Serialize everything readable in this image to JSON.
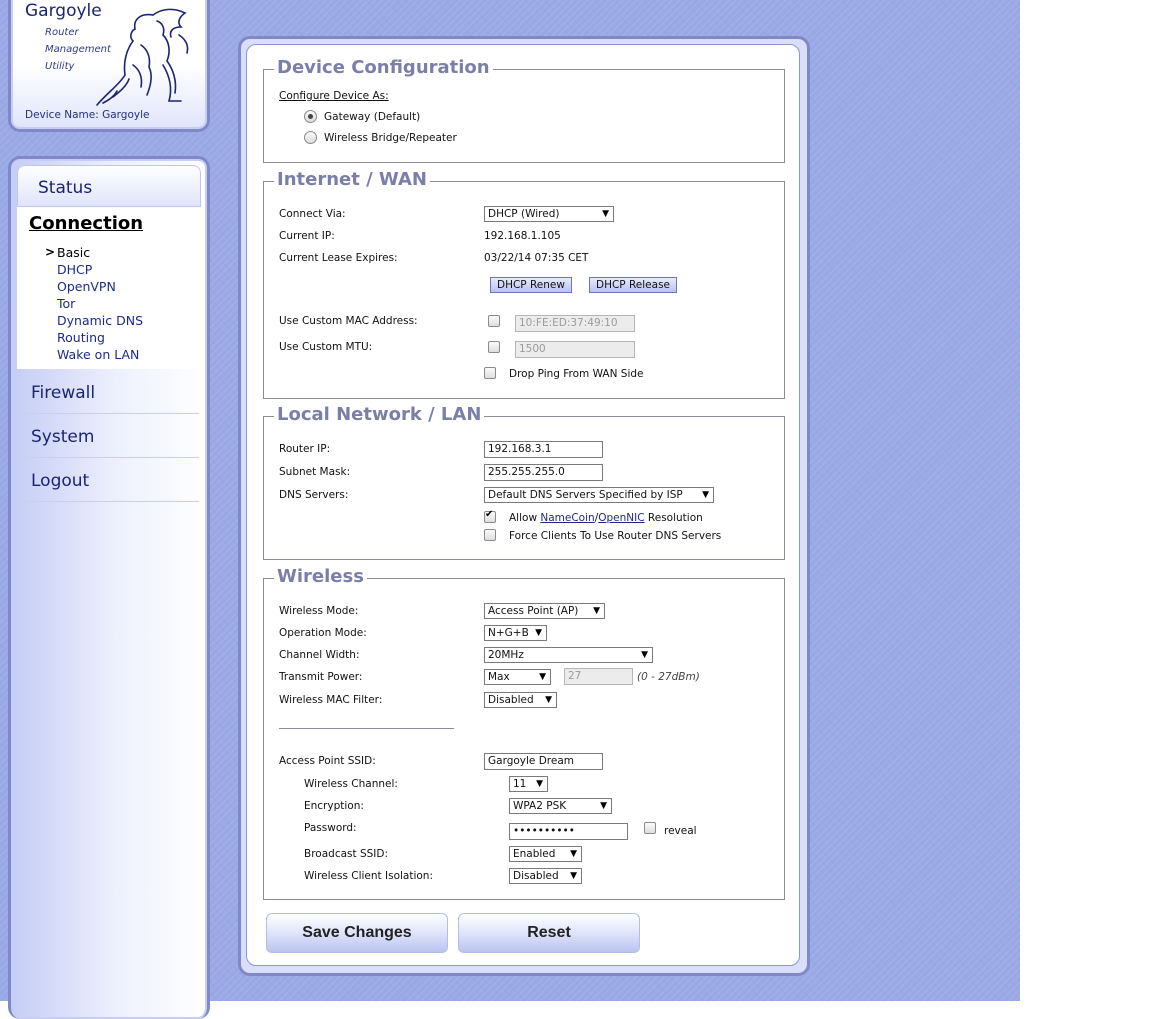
{
  "logo": {
    "title": "Gargoyle",
    "sub1": "Router",
    "sub2": "Management",
    "sub3": "Utility",
    "device_name": "Device Name: Gargoyle"
  },
  "nav": {
    "status": "Status",
    "connection": "Connection",
    "active_marker": ">",
    "sub_items": [
      "Basic",
      "DHCP",
      "OpenVPN",
      "Tor",
      "Dynamic DNS",
      "Routing",
      "Wake on LAN"
    ],
    "firewall": "Firewall",
    "system": "System",
    "logout": "Logout"
  },
  "device_config": {
    "legend": "Device Configuration",
    "configure_as": "Configure Device As:",
    "opt_gateway": "Gateway (Default)",
    "opt_bridge": "Wireless Bridge/Repeater",
    "selected": "Gateway (Default)"
  },
  "wan": {
    "legend": "Internet / WAN",
    "connect_via_label": "Connect Via:",
    "connect_via": "DHCP (Wired)",
    "current_ip_label": "Current IP:",
    "current_ip": "192.168.1.105",
    "lease_label": "Current Lease Expires:",
    "lease": "03/22/14 07:35 CET",
    "renew": "DHCP Renew",
    "release": "DHCP Release",
    "mac_label": "Use Custom MAC Address:",
    "mac_value": "10:FE:ED:37:49:10",
    "mtu_label": "Use Custom MTU:",
    "mtu_value": "1500",
    "drop_ping": "Drop Ping From WAN Side"
  },
  "lan": {
    "legend": "Local Network / LAN",
    "router_ip_label": "Router IP:",
    "router_ip": "192.168.3.1",
    "subnet_label": "Subnet Mask:",
    "subnet": "255.255.255.0",
    "dns_label": "DNS Servers:",
    "dns": "Default DNS Servers Specified by ISP",
    "allow_prefix": "Allow",
    "namecoin": "NameCoin",
    "slash": "/",
    "opennic": "OpenNIC",
    "allow_suffix": "Resolution",
    "force_dns": "Force Clients To Use Router DNS Servers"
  },
  "wireless": {
    "legend": "Wireless",
    "mode_label": "Wireless Mode:",
    "mode": "Access Point (AP)",
    "op_label": "Operation Mode:",
    "op": "N+G+B",
    "width_label": "Channel Width:",
    "width": "20MHz",
    "power_label": "Transmit Power:",
    "power": "Max",
    "power_value": "27",
    "power_range": "(0 - 27dBm)",
    "mac_filter_label": "Wireless MAC Filter:",
    "mac_filter": "Disabled",
    "ssid_label": "Access Point SSID:",
    "ssid": "Gargoyle Dream",
    "channel_label": "Wireless Channel:",
    "channel": "11",
    "enc_label": "Encryption:",
    "enc": "WPA2 PSK",
    "pass_label": "Password:",
    "pass": "••••••••••",
    "reveal": "reveal",
    "broadcast_label": "Broadcast SSID:",
    "broadcast": "Enabled",
    "isolation_label": "Wireless Client Isolation:",
    "isolation": "Disabled"
  },
  "actions": {
    "save": "Save Changes",
    "reset": "Reset"
  },
  "colors": {
    "background": "#9aa9e6",
    "accent": "#1b2470",
    "legend": "#7a7fa8"
  }
}
